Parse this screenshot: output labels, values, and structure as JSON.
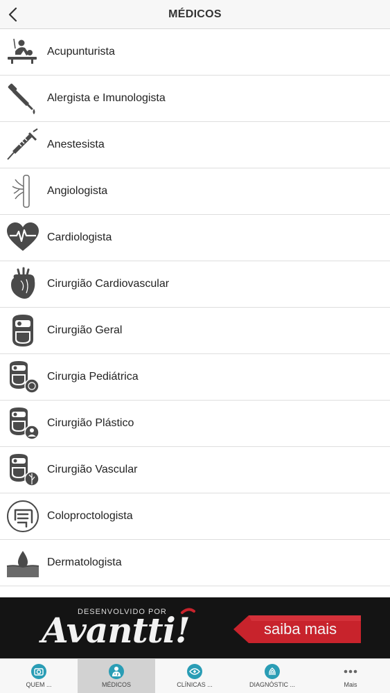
{
  "header": {
    "title": "MÉDICOS",
    "back_icon": "chevron-left-icon"
  },
  "specialties": [
    {
      "label": "Acupunturista",
      "icon": "acupuncture-icon"
    },
    {
      "label": "Alergista e Imunologista",
      "icon": "dropper-icon"
    },
    {
      "label": "Anestesista",
      "icon": "syringe-icon"
    },
    {
      "label": "Angiologista",
      "icon": "vein-icon"
    },
    {
      "label": "Cardiologista",
      "icon": "heart-pulse-icon"
    },
    {
      "label": "Cirurgião Cardiovascular",
      "icon": "anatomical-heart-icon"
    },
    {
      "label": "Cirurgião Geral",
      "icon": "surgeon-icon"
    },
    {
      "label": "Cirurgia Pediátrica",
      "icon": "surgeon-baby-icon"
    },
    {
      "label": "Cirurgião Plástico",
      "icon": "surgeon-face-icon"
    },
    {
      "label": "Cirurgião Vascular",
      "icon": "surgeon-vein-icon"
    },
    {
      "label": "Coloproctologista",
      "icon": "intestine-icon"
    },
    {
      "label": "Dermatologista",
      "icon": "skin-drop-icon"
    }
  ],
  "banner": {
    "developed_by": "DESENVOLVIDO POR",
    "brand": "Avantti!",
    "cta": "saiba mais",
    "accent": "#c8232c"
  },
  "tabs": [
    {
      "label": "QUEM ...",
      "icon": "camera-icon",
      "active": false
    },
    {
      "label": "MÉDICOS",
      "icon": "doctor-icon",
      "active": true
    },
    {
      "label": "CLÍNICAS ...",
      "icon": "clinic-icon",
      "active": false
    },
    {
      "label": "DIAGNÓSTIC ...",
      "icon": "fingerprint-icon",
      "active": false
    },
    {
      "label": "Mais",
      "icon": "more-dots-icon",
      "active": false
    }
  ],
  "colors": {
    "tab_icon": "#2a9db5",
    "list_icon": "#4a4a4a"
  }
}
